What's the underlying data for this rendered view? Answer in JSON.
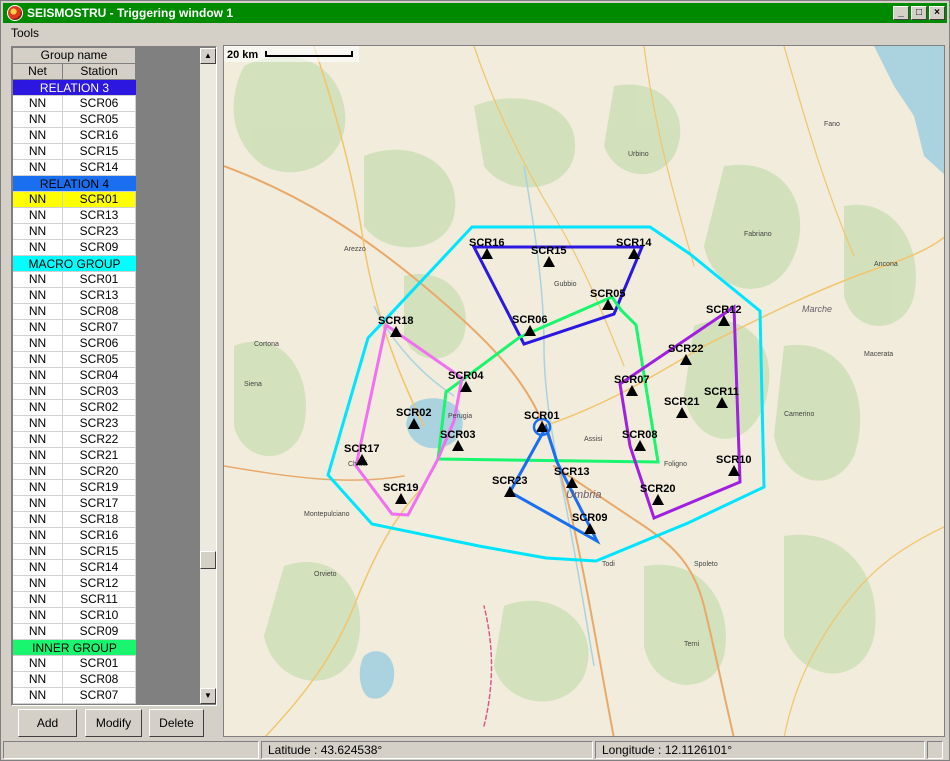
{
  "window": {
    "title": "SEISMOSTRU - Triggering window 1",
    "controls": {
      "minimize": "_",
      "maximize": "□",
      "close": "×"
    }
  },
  "menu": {
    "tools": "Tools"
  },
  "table": {
    "group_header": "Group name",
    "col_net": "Net",
    "col_station": "Station",
    "rows": [
      {
        "type": "group",
        "label": "RELATION 3",
        "color": "#2b17e0",
        "text_color": "#ffffff"
      },
      {
        "type": "row",
        "net": "NN",
        "station": "SCR06"
      },
      {
        "type": "row",
        "net": "NN",
        "station": "SCR05"
      },
      {
        "type": "row",
        "net": "NN",
        "station": "SCR16"
      },
      {
        "type": "row",
        "net": "NN",
        "station": "SCR15"
      },
      {
        "type": "row",
        "net": "NN",
        "station": "SCR14"
      },
      {
        "type": "group",
        "label": "RELATION 4",
        "color": "#1a6ef0",
        "text_color": "#000000"
      },
      {
        "type": "row",
        "net": "NN",
        "station": "SCR01",
        "highlight": "#ffff00"
      },
      {
        "type": "row",
        "net": "NN",
        "station": "SCR13"
      },
      {
        "type": "row",
        "net": "NN",
        "station": "SCR23"
      },
      {
        "type": "row",
        "net": "NN",
        "station": "SCR09"
      },
      {
        "type": "group",
        "label": "MACRO GROUP",
        "color": "#00ffff",
        "text_color": "#000000"
      },
      {
        "type": "row",
        "net": "NN",
        "station": "SCR01"
      },
      {
        "type": "row",
        "net": "NN",
        "station": "SCR13"
      },
      {
        "type": "row",
        "net": "NN",
        "station": "SCR08"
      },
      {
        "type": "row",
        "net": "NN",
        "station": "SCR07"
      },
      {
        "type": "row",
        "net": "NN",
        "station": "SCR06"
      },
      {
        "type": "row",
        "net": "NN",
        "station": "SCR05"
      },
      {
        "type": "row",
        "net": "NN",
        "station": "SCR04"
      },
      {
        "type": "row",
        "net": "NN",
        "station": "SCR03"
      },
      {
        "type": "row",
        "net": "NN",
        "station": "SCR02"
      },
      {
        "type": "row",
        "net": "NN",
        "station": "SCR23"
      },
      {
        "type": "row",
        "net": "NN",
        "station": "SCR22"
      },
      {
        "type": "row",
        "net": "NN",
        "station": "SCR21"
      },
      {
        "type": "row",
        "net": "NN",
        "station": "SCR20"
      },
      {
        "type": "row",
        "net": "NN",
        "station": "SCR19"
      },
      {
        "type": "row",
        "net": "NN",
        "station": "SCR17"
      },
      {
        "type": "row",
        "net": "NN",
        "station": "SCR18"
      },
      {
        "type": "row",
        "net": "NN",
        "station": "SCR16"
      },
      {
        "type": "row",
        "net": "NN",
        "station": "SCR15"
      },
      {
        "type": "row",
        "net": "NN",
        "station": "SCR14"
      },
      {
        "type": "row",
        "net": "NN",
        "station": "SCR12"
      },
      {
        "type": "row",
        "net": "NN",
        "station": "SCR11"
      },
      {
        "type": "row",
        "net": "NN",
        "station": "SCR10"
      },
      {
        "type": "row",
        "net": "NN",
        "station": "SCR09"
      },
      {
        "type": "group",
        "label": "INNER GROUP",
        "color": "#19f56e",
        "text_color": "#000000"
      },
      {
        "type": "row",
        "net": "NN",
        "station": "SCR01"
      },
      {
        "type": "row",
        "net": "NN",
        "station": "SCR08"
      },
      {
        "type": "row",
        "net": "NN",
        "station": "SCR07"
      }
    ]
  },
  "buttons": {
    "add": "Add",
    "modify": "Modify",
    "delete": "Delete"
  },
  "map": {
    "scale_label": "20 km",
    "region_label": "Umbria",
    "region_label2": "Marche",
    "stations": [
      "SCR16",
      "SCR15",
      "SCR14",
      "SCR05",
      "SCR06",
      "SCR12",
      "SCR18",
      "SCR22",
      "SCR04",
      "SCR07",
      "SCR11",
      "SCR21",
      "SCR02",
      "SCR01",
      "SCR03",
      "SCR08",
      "SCR17",
      "SCR10",
      "SCR13",
      "SCR23",
      "SCR20",
      "SCR19",
      "SCR09"
    ],
    "towns": [
      "Arezzo",
      "Cortona",
      "Perugia",
      "Assisi",
      "Foligno",
      "Gubbio",
      "Urbino",
      "Todi",
      "Spoleto",
      "Terni",
      "Orvieto",
      "Fabriano",
      "Camerino",
      "Macerata",
      "Ancona",
      "Fano",
      "Siena",
      "Chiusi",
      "Montepulciano"
    ],
    "colors": {
      "macro": "#00e5ff",
      "relation3": "#2b17e0",
      "relation4": "#1a6ef0",
      "inner": "#19f56e",
      "magenta": "#f070f0",
      "purple": "#a020e0"
    }
  },
  "status": {
    "left": "",
    "latitude": "Latitude : 43.624538°",
    "longitude": "Longitude : 12.1126101°"
  }
}
